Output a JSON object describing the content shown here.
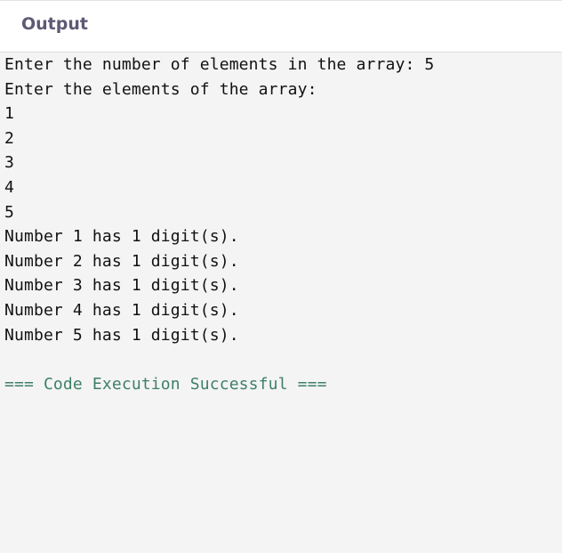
{
  "header": {
    "title": "Output"
  },
  "console": {
    "lines": [
      "Enter the number of elements in the array: 5",
      "Enter the elements of the array:",
      "1",
      "2",
      "3",
      "4",
      "5",
      "Number 1 has 1 digit(s).",
      "Number 2 has 1 digit(s).",
      "Number 3 has 1 digit(s).",
      "Number 4 has 1 digit(s).",
      "Number 5 has 1 digit(s).",
      "",
      "=== Code Execution Successful ==="
    ],
    "success_color": "#3e7f66"
  }
}
